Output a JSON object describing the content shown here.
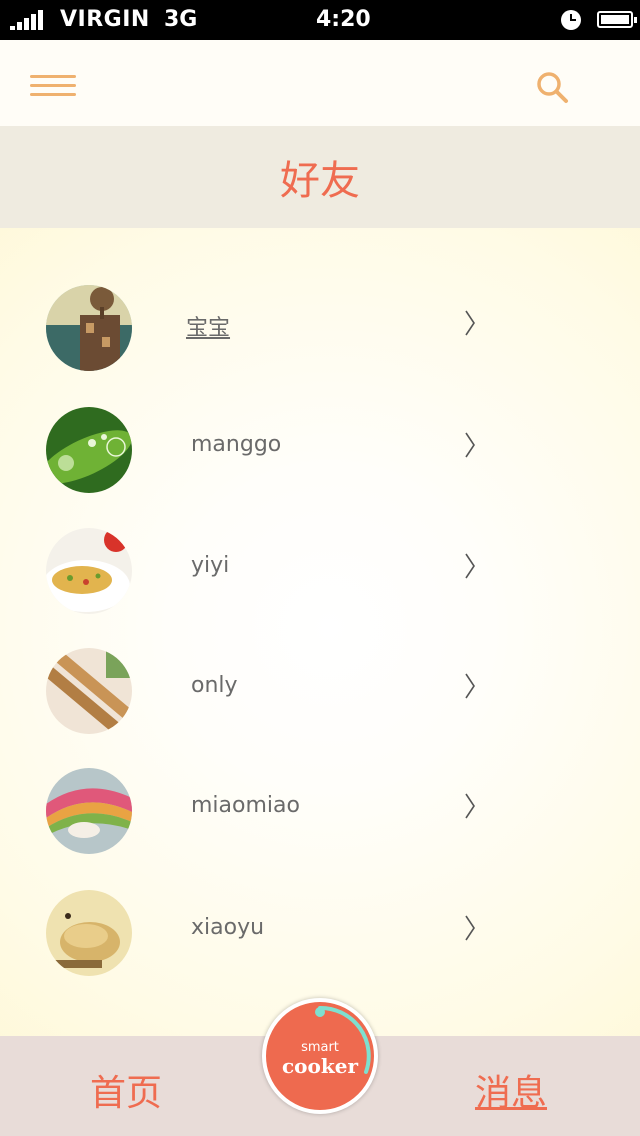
{
  "status_bar": {
    "carrier": "VIRGIN",
    "network": "3G",
    "time": "4:20"
  },
  "header": {
    "menu_icon": "hamburger-menu-icon",
    "search_icon": "search-icon"
  },
  "page_title": "好友",
  "friends": [
    {
      "name": "宝宝",
      "avatar": "treehouse-photo"
    },
    {
      "name": "manggo",
      "avatar": "green-leaf-photo"
    },
    {
      "name": "yiyi",
      "avatar": "noodle-dish-photo"
    },
    {
      "name": "only",
      "avatar": "breadsticks-photo"
    },
    {
      "name": "miaomiao",
      "avatar": "rainbow-cake-photo"
    },
    {
      "name": "xiaoyu",
      "avatar": "dumplings-photo"
    }
  ],
  "bottom_nav": {
    "home_label": "首页",
    "messages_label": "消息",
    "center_small": "smart",
    "center_big": "cooker"
  },
  "colors": {
    "accent": "#ef6c50",
    "icon_orange": "#efb16f",
    "title_band": "#efebe0",
    "bottom_bar": "#e8dcd8"
  }
}
